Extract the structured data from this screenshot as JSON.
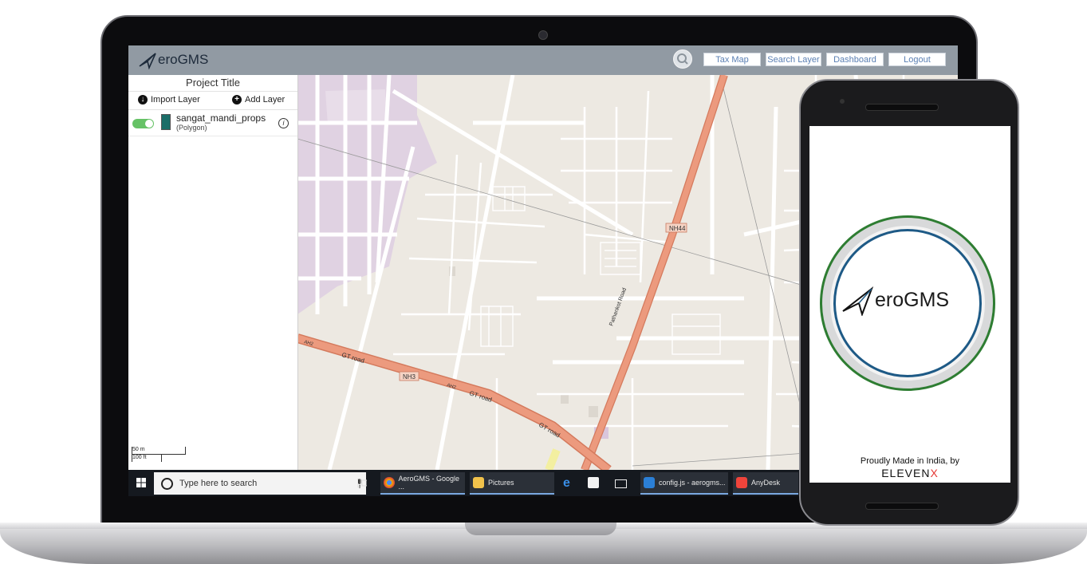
{
  "app": {
    "brand": "AeroGMS",
    "brand_suffix": "eroGMS",
    "nav": [
      "Tax Map",
      "Search Layer",
      "Dashboard",
      "Logout"
    ]
  },
  "panel": {
    "title": "Project Title",
    "import_label": "Import Layer",
    "add_label": "Add Layer",
    "layer": {
      "name": "sangat_mandi_props",
      "type": "(Polygon)",
      "enabled": true,
      "color": "#1b6e68"
    },
    "scale": [
      "50 m",
      "100 ft"
    ]
  },
  "map": {
    "labels": [
      "NH44",
      "Pathankot Road",
      "GT road",
      "GT road",
      "GT road",
      "NH3",
      "AH2",
      "AH2"
    ]
  },
  "taskbar": {
    "search_placeholder": "Type here to search",
    "apps": [
      "AeroGMS - Google ...",
      "Pictures",
      "config.js - aerogms...",
      "AnyDesk"
    ]
  },
  "phone": {
    "splash_brand": "eroGMS",
    "tagline": "Proudly Made in India, by",
    "maker": "ELEVEN",
    "maker_x": "X"
  }
}
